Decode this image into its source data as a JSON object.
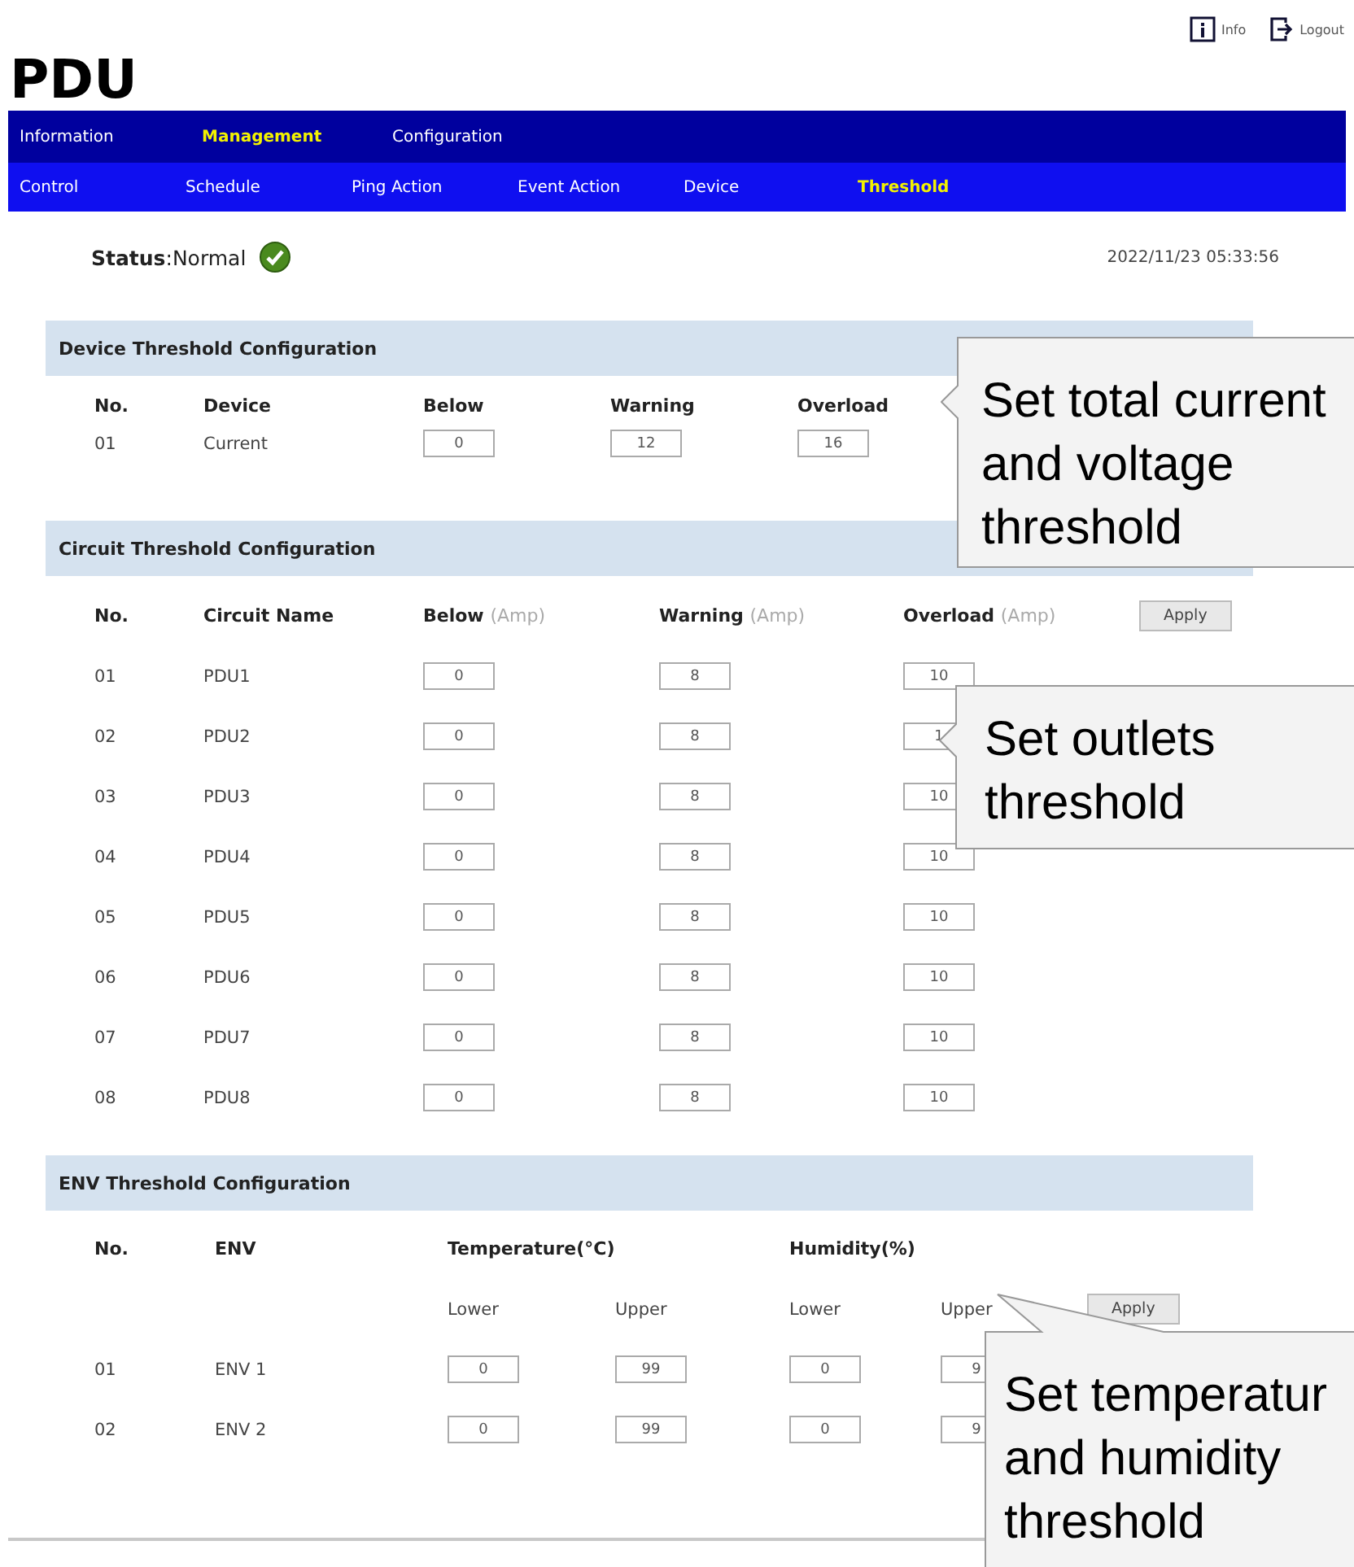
{
  "header": {
    "logo": "PDU",
    "links": [
      {
        "kind": "info",
        "label": "Info"
      },
      {
        "kind": "logout",
        "label": "Logout"
      }
    ]
  },
  "nav": {
    "primary": [
      {
        "label": "Information",
        "selected": false
      },
      {
        "label": "Management",
        "selected": true
      },
      {
        "label": "Configuration",
        "selected": false
      }
    ],
    "secondary": [
      {
        "label": "Control",
        "selected": false
      },
      {
        "label": "Schedule",
        "selected": false
      },
      {
        "label": "Ping Action",
        "selected": false
      },
      {
        "label": "Event Action",
        "selected": false
      },
      {
        "label": "Device",
        "selected": false
      },
      {
        "label": "Threshold",
        "selected": true
      }
    ]
  },
  "status": {
    "text": "**Status**:Normal",
    "timestamp": "2022/11/23 05:33:56"
  },
  "device_section": {
    "title": "Device Threshold Configuration",
    "columns": [
      "No.",
      "Device",
      "Below",
      "Warning",
      "Overload"
    ],
    "rows": [
      {
        "no": "01",
        "device": "Current",
        "below": "0",
        "warning": "12",
        "overload": "16"
      }
    ]
  },
  "circuit_section": {
    "title": "Circuit Threshold Configuration",
    "columns": [
      {
        "label": "No."
      },
      {
        "label": "Circuit Name"
      },
      {
        "label": "Below",
        "unit": "(Amp)"
      },
      {
        "label": "Warning",
        "unit": "(Amp)"
      },
      {
        "label": "Overload",
        "unit": "(Amp)"
      }
    ],
    "apply": "Apply",
    "rows": [
      {
        "no": "01",
        "name": "PDU1",
        "below": "0",
        "warning": "8",
        "overload": "10"
      },
      {
        "no": "02",
        "name": "PDU2",
        "below": "0",
        "warning": "8",
        "overload": "1"
      },
      {
        "no": "03",
        "name": "PDU3",
        "below": "0",
        "warning": "8",
        "overload": "10"
      },
      {
        "no": "04",
        "name": "PDU4",
        "below": "0",
        "warning": "8",
        "overload": "10"
      },
      {
        "no": "05",
        "name": "PDU5",
        "below": "0",
        "warning": "8",
        "overload": "10"
      },
      {
        "no": "06",
        "name": "PDU6",
        "below": "0",
        "warning": "8",
        "overload": "10"
      },
      {
        "no": "07",
        "name": "PDU7",
        "below": "0",
        "warning": "8",
        "overload": "10"
      },
      {
        "no": "08",
        "name": "PDU8",
        "below": "0",
        "warning": "8",
        "overload": "10"
      }
    ]
  },
  "env_section": {
    "title": "ENV Threshold Configuration",
    "columns": [
      "No.",
      "ENV",
      "Temperature(°C)",
      "Humidity(%)"
    ],
    "subcolumns": [
      "Lower",
      "Upper",
      "Lower",
      "Upper"
    ],
    "apply": "Apply",
    "rows": [
      {
        "no": "01",
        "name": "ENV 1",
        "temp_lower": "0",
        "temp_upper": "99",
        "hum_lower": "0",
        "hum_upper": "9"
      },
      {
        "no": "02",
        "name": "ENV 2",
        "temp_lower": "0",
        "temp_upper": "99",
        "hum_lower": "0",
        "hum_upper": "9"
      }
    ]
  },
  "callouts": [
    {
      "text": "Set total current and voltage threshold"
    },
    {
      "text": "Set outlets threshold"
    },
    {
      "text": "Set temperatur and humidity threshold"
    }
  ]
}
